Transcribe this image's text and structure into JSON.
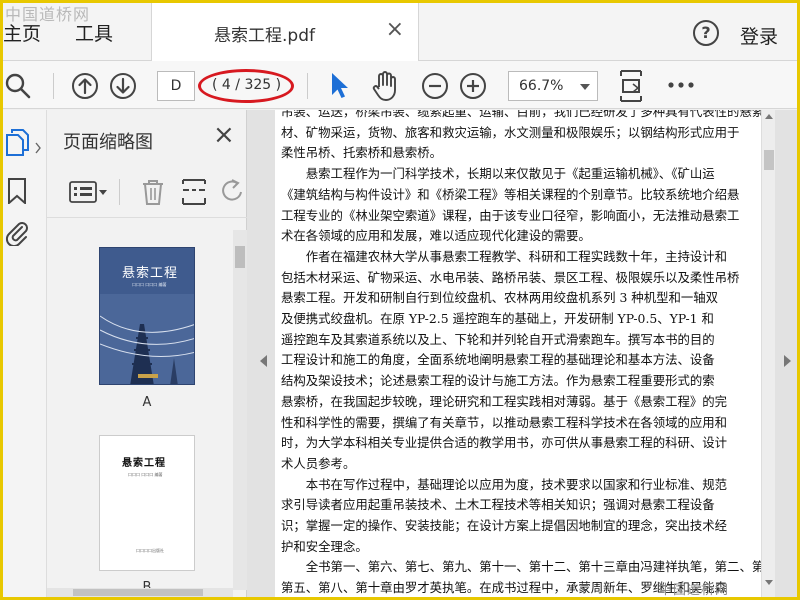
{
  "watermark": "中国道桥网",
  "menu": {
    "home": "主页",
    "tools": "工具"
  },
  "tab": {
    "title": "悬索工程.pdf",
    "close": "×"
  },
  "header": {
    "help": "?",
    "login": "登录"
  },
  "toolbar": {
    "current_page": "D",
    "page_count": "4 / 325",
    "zoom": "66.7%"
  },
  "thumbnail_panel": {
    "title": "页面缩略图",
    "close": "×",
    "thumbnails": [
      {
        "label": "A",
        "cover_title": "悬索工程",
        "cover_sub": "口口口  口口口  编著"
      },
      {
        "label": "B",
        "cover_title": "悬索工程",
        "cover_sub": "口口口 口口口 编著",
        "cover_pub": "口口口口出版社"
      }
    ]
  },
  "document": {
    "lines": [
      "吊装、运送，桥梁吊装、缆索起重、运输、目前，我们已经研发了多种具有代表性的悬索",
      "材、矿物采运，货物、旅客和救灾运输，水文测量和极限娱乐；以钢结构形式应用于",
      "柔性吊桥、托索桥和悬索桥。",
      "　　悬索工程作为一门科学技术，长期以来仅散见于《起重运输机械》、《矿山运",
      "《建筑结构与构件设计》和《桥梁工程》等相关课程的个别章节。比较系统地介绍悬",
      "工程专业的《林业架空索道》课程，由于该专业口径窄，影响面小，无法推动悬索工",
      "术在各领域的应用和发展，难以适应现代化建设的需要。",
      "　　作者在福建农林大学从事悬索工程教学、科研和工程实践数十年，主持设计和",
      "包括木材采运、矿物采运、水电吊装、路桥吊装、景区工程、极限娱乐以及柔性吊桥",
      "悬索工程。开发和研制自行到位绞盘机、农林两用绞盘机系列 3 种机型和一轴双",
      "及便携式绞盘机。在原 YP-2.5 遥控跑车的基础上，开发研制 YP-0.5、YP-1 和",
      "遥控跑车及其索道系统以及上、下轮和并列轮自开式滑索跑车。撰写本书的目的",
      "工程设计和施工的角度，全面系统地阐明悬索工程的基础理论和基本方法、设备",
      "结构及架设技术；论述悬索工程的设计与施工方法。作为悬索工程重要形式的索",
      "悬索桥，在我国起步较晚，理论研究和工程实践相对薄弱。基于《悬索工程》的完",
      "性和科学性的需要，撰编了有关章节，以推动悬索工程科学技术在各领域的应用和",
      "时，为大学本科相关专业提供合适的教学用书，亦可供从事悬索工程的科研、设计",
      "术人员参考。",
      "　　本书在写作过程中，基础理论以应用为度，技术要求以国家和行业标准、规范",
      "求引导读者应用起重吊装技术、土木工程技术等相关知识；强调对悬索工程设备",
      "识；掌握一定的操作、安装技能；在设计方案上提倡因地制宜的理念，突出技术经",
      "护和安全理念。",
      "　　全书第一、第六、第七、第九、第十一、第十二、第十三章由冯建祥执笔，第二、第",
      "第五、第八、第十章由罗才英执笔。在成书过程中，承蒙周新年、罗继生和吴能森"
    ]
  },
  "bottom_watermark": "中国道桥网"
}
